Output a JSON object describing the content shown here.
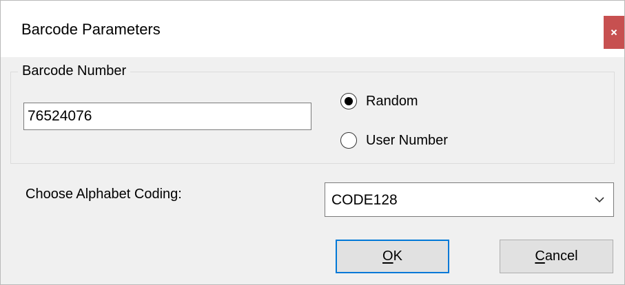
{
  "window": {
    "title": "Barcode Parameters",
    "close_glyph": "x",
    "close_color": "#c75050"
  },
  "barcode_group": {
    "legend": "Barcode Number",
    "number_value": "76524076",
    "radio_random": {
      "label": "Random",
      "selected": true
    },
    "radio_user": {
      "label": "User Number",
      "selected": false
    }
  },
  "coding": {
    "label": "Choose Alphabet Coding:",
    "selected": "CODE128"
  },
  "buttons": {
    "ok_label": "OK",
    "cancel_label": "Cancel",
    "default_border_color": "#0078d7"
  }
}
